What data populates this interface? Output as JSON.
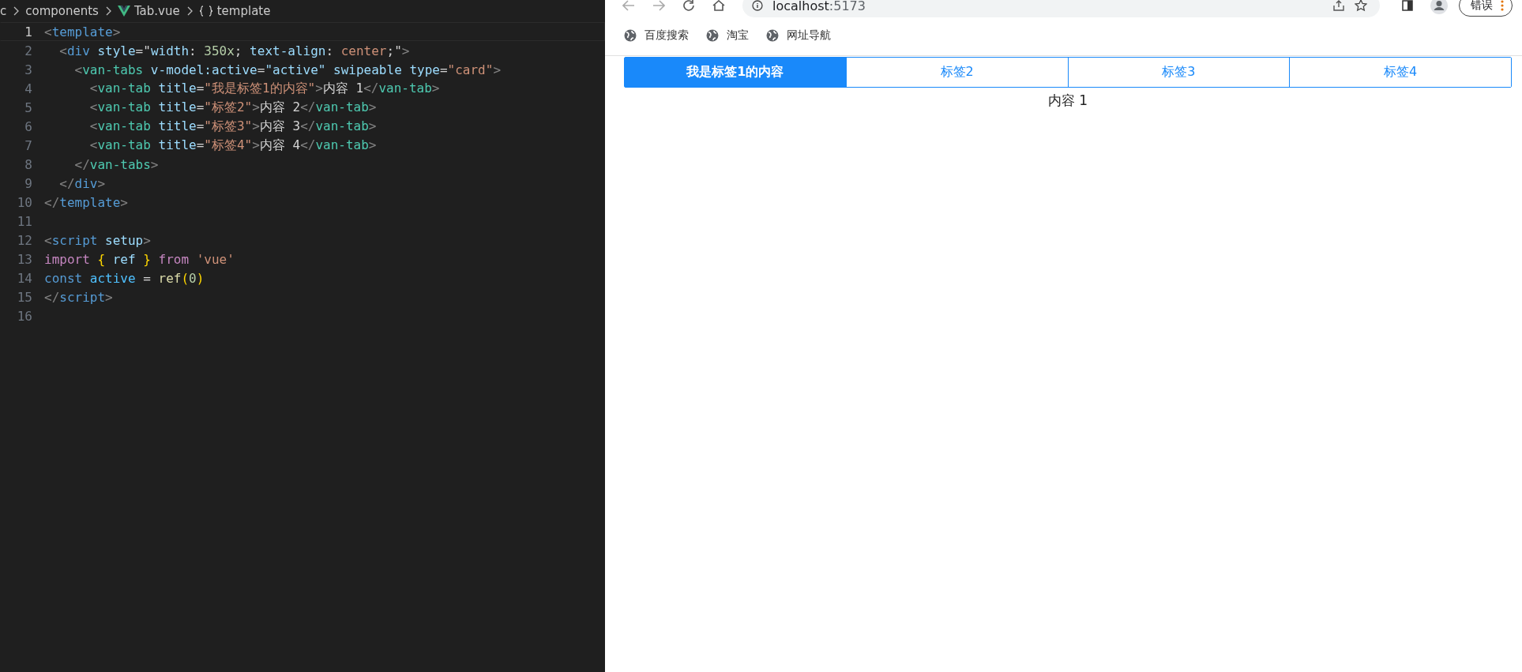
{
  "editor": {
    "breadcrumbs": [
      {
        "text": "c",
        "kind": "folder"
      },
      {
        "text": "components",
        "kind": "folder"
      },
      {
        "text": "Tab.vue",
        "kind": "file"
      },
      {
        "text": "template",
        "kind": "symbol"
      }
    ],
    "lines": [
      {
        "number": "1",
        "active": true,
        "tokens": [
          {
            "text": "<",
            "kind": "punct"
          },
          {
            "text": "template",
            "kind": "tag"
          },
          {
            "text": ">",
            "kind": "punct"
          }
        ]
      },
      {
        "number": "2",
        "active": false,
        "tokens": [
          {
            "text": "  <",
            "kind": "punct"
          },
          {
            "text": "div",
            "kind": "tag"
          },
          {
            "text": " style",
            "kind": "attr"
          },
          {
            "text": "=\"",
            "kind": "text"
          },
          {
            "text": "width",
            "kind": "attr"
          },
          {
            "text": ": ",
            "kind": "text"
          },
          {
            "text": "350x",
            "kind": "number"
          },
          {
            "text": "; ",
            "kind": "text"
          },
          {
            "text": "text-align",
            "kind": "attr"
          },
          {
            "text": ": ",
            "kind": "text"
          },
          {
            "text": "center",
            "kind": "string"
          },
          {
            "text": ";\"",
            "kind": "text"
          },
          {
            "text": ">",
            "kind": "punct"
          }
        ]
      },
      {
        "number": "3",
        "active": false,
        "tokens": [
          {
            "text": "    <",
            "kind": "punct"
          },
          {
            "text": "van-tabs",
            "kind": "component"
          },
          {
            "text": " v-model:active",
            "kind": "attr"
          },
          {
            "text": "=",
            "kind": "text"
          },
          {
            "text": "\"active\"",
            "kind": "attr"
          },
          {
            "text": " swipeable type",
            "kind": "attr"
          },
          {
            "text": "=",
            "kind": "text"
          },
          {
            "text": "\"card\"",
            "kind": "string"
          },
          {
            "text": ">",
            "kind": "punct"
          }
        ]
      },
      {
        "number": "4",
        "active": false,
        "tokens": [
          {
            "text": "      <",
            "kind": "punct"
          },
          {
            "text": "van-tab",
            "kind": "component"
          },
          {
            "text": " title",
            "kind": "attr"
          },
          {
            "text": "=",
            "kind": "text"
          },
          {
            "text": "\"我是标签1的内容\"",
            "kind": "string"
          },
          {
            "text": ">",
            "kind": "punct"
          },
          {
            "text": "内容 1",
            "kind": "text"
          },
          {
            "text": "</",
            "kind": "punct"
          },
          {
            "text": "van-tab",
            "kind": "component"
          },
          {
            "text": ">",
            "kind": "punct"
          }
        ]
      },
      {
        "number": "5",
        "active": false,
        "tokens": [
          {
            "text": "      <",
            "kind": "punct"
          },
          {
            "text": "van-tab",
            "kind": "component"
          },
          {
            "text": " title",
            "kind": "attr"
          },
          {
            "text": "=",
            "kind": "text"
          },
          {
            "text": "\"标签2\"",
            "kind": "string"
          },
          {
            "text": ">",
            "kind": "punct"
          },
          {
            "text": "内容 2",
            "kind": "text"
          },
          {
            "text": "</",
            "kind": "punct"
          },
          {
            "text": "van-tab",
            "kind": "component"
          },
          {
            "text": ">",
            "kind": "punct"
          }
        ]
      },
      {
        "number": "6",
        "active": false,
        "tokens": [
          {
            "text": "      <",
            "kind": "punct"
          },
          {
            "text": "van-tab",
            "kind": "component"
          },
          {
            "text": " title",
            "kind": "attr"
          },
          {
            "text": "=",
            "kind": "text"
          },
          {
            "text": "\"标签3\"",
            "kind": "string"
          },
          {
            "text": ">",
            "kind": "punct"
          },
          {
            "text": "内容 3",
            "kind": "text"
          },
          {
            "text": "</",
            "kind": "punct"
          },
          {
            "text": "van-tab",
            "kind": "component"
          },
          {
            "text": ">",
            "kind": "punct"
          }
        ]
      },
      {
        "number": "7",
        "active": false,
        "tokens": [
          {
            "text": "      <",
            "kind": "punct"
          },
          {
            "text": "van-tab",
            "kind": "component"
          },
          {
            "text": " title",
            "kind": "attr"
          },
          {
            "text": "=",
            "kind": "text"
          },
          {
            "text": "\"标签4\"",
            "kind": "string"
          },
          {
            "text": ">",
            "kind": "punct"
          },
          {
            "text": "内容 4",
            "kind": "text"
          },
          {
            "text": "</",
            "kind": "punct"
          },
          {
            "text": "van-tab",
            "kind": "component"
          },
          {
            "text": ">",
            "kind": "punct"
          }
        ]
      },
      {
        "number": "8",
        "active": false,
        "tokens": [
          {
            "text": "    </",
            "kind": "punct"
          },
          {
            "text": "van-tabs",
            "kind": "component"
          },
          {
            "text": ">",
            "kind": "punct"
          }
        ]
      },
      {
        "number": "9",
        "active": false,
        "tokens": [
          {
            "text": "  </",
            "kind": "punct"
          },
          {
            "text": "div",
            "kind": "tag"
          },
          {
            "text": ">",
            "kind": "punct"
          }
        ]
      },
      {
        "number": "10",
        "active": false,
        "tokens": [
          {
            "text": "</",
            "kind": "punct"
          },
          {
            "text": "template",
            "kind": "tag"
          },
          {
            "text": ">",
            "kind": "punct"
          }
        ]
      },
      {
        "number": "11",
        "active": false
      },
      {
        "number": "12",
        "active": false,
        "tokens": [
          {
            "text": "<",
            "kind": "punct"
          },
          {
            "text": "script",
            "kind": "tag"
          },
          {
            "text": " setup",
            "kind": "attr"
          },
          {
            "text": ">",
            "kind": "punct"
          }
        ]
      },
      {
        "number": "13",
        "active": false,
        "tokens": [
          {
            "text": "import",
            "kind": "keyword"
          },
          {
            "text": " {",
            "kind": "bracket"
          },
          {
            "text": " ref ",
            "kind": "attr"
          },
          {
            "text": "}",
            "kind": "bracket"
          },
          {
            "text": " from",
            "kind": "keyword"
          },
          {
            "text": " 'vue'",
            "kind": "string"
          }
        ]
      },
      {
        "number": "14",
        "active": false,
        "tokens": [
          {
            "text": "const",
            "kind": "tag"
          },
          {
            "text": " active",
            "kind": "constant"
          },
          {
            "text": " = ",
            "kind": "text"
          },
          {
            "text": "ref",
            "kind": "function"
          },
          {
            "text": "(",
            "kind": "bracket"
          },
          {
            "text": "0",
            "kind": "number"
          },
          {
            "text": ")",
            "kind": "bracket"
          }
        ]
      },
      {
        "number": "15",
        "active": false,
        "tokens": [
          {
            "text": "</",
            "kind": "punct"
          },
          {
            "text": "script",
            "kind": "tag"
          },
          {
            "text": ">",
            "kind": "punct"
          }
        ]
      },
      {
        "number": "16",
        "active": false
      }
    ]
  },
  "browser": {
    "address": {
      "host": "localhost",
      "port": ":5173"
    },
    "profile_button": "错误",
    "bookmarks": [
      {
        "label": "百度搜索"
      },
      {
        "label": "淘宝"
      },
      {
        "label": "网址导航"
      }
    ],
    "tabs": [
      {
        "label": "我是标签1的内容",
        "selected": true
      },
      {
        "label": "标签2",
        "selected": false
      },
      {
        "label": "标签3",
        "selected": false
      },
      {
        "label": "标签4",
        "selected": false
      }
    ],
    "content": "内容 1"
  }
}
